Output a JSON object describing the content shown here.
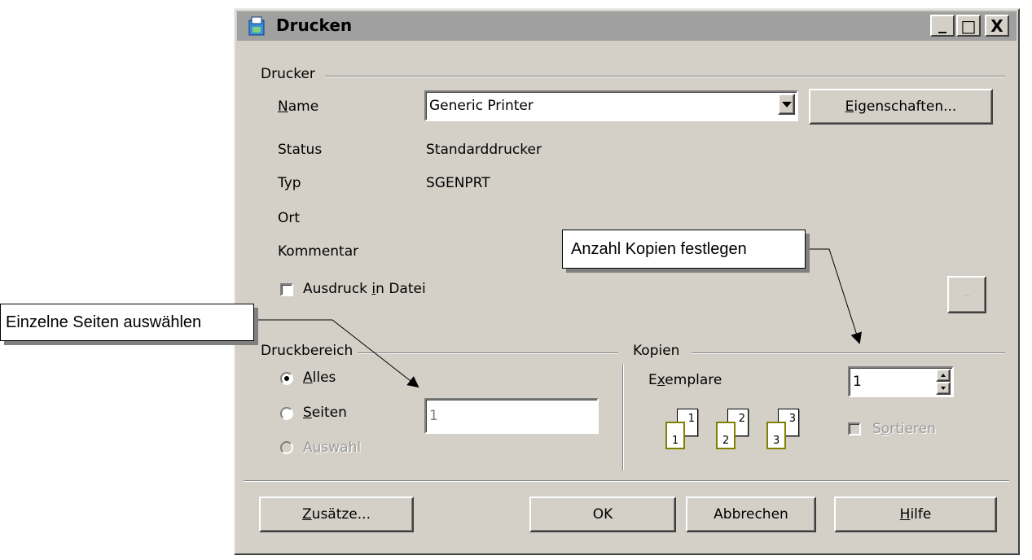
{
  "dialog": {
    "title": "Drucken",
    "window_controls": {
      "minimize": "_",
      "maximize": "□",
      "close": "X"
    }
  },
  "printer": {
    "group_label": "Drucker",
    "name_label_accel": "N",
    "name_label_rest": "ame",
    "name_value": "Generic Printer",
    "properties_accel": "E",
    "properties_rest": "igenschaften...",
    "status_label": "Status",
    "status_value": "Standarddrucker",
    "type_label": "Typ",
    "type_value": "SGENPRT",
    "location_label": "Ort",
    "comment_label": "Kommentar",
    "print_to_file_pre": "Ausdruck ",
    "print_to_file_accel": "i",
    "print_to_file_post": "n Datei",
    "print_to_file_checked": false,
    "browse_label": "..."
  },
  "range": {
    "group_label": "Druckbereich",
    "all_accel": "A",
    "all_rest": "lles",
    "all_selected": true,
    "pages_accel": "S",
    "pages_rest": "eiten",
    "pages_value": "1",
    "selection_pre": "A",
    "selection_accel": "u",
    "selection_post": "swahl"
  },
  "copies": {
    "group_label": "Kopien",
    "count_pre": "E",
    "count_accel": "x",
    "count_post": "emplare",
    "count_value": "1",
    "collate_pre": "S",
    "collate_accel": "o",
    "collate_post": "rtieren",
    "collate_checked": false,
    "page_icons": [
      {
        "back": "1",
        "front": "1"
      },
      {
        "back": "2",
        "front": "2"
      },
      {
        "back": "3",
        "front": "3"
      }
    ]
  },
  "buttons": {
    "extras_accel": "Z",
    "extras_rest": "usätze...",
    "ok": "OK",
    "cancel": "Abbrechen",
    "help_accel": "H",
    "help_rest": "ilfe"
  },
  "callouts": {
    "copies": "Anzahl Kopien festlegen",
    "pages": "Einzelne Seiten auswählen"
  }
}
